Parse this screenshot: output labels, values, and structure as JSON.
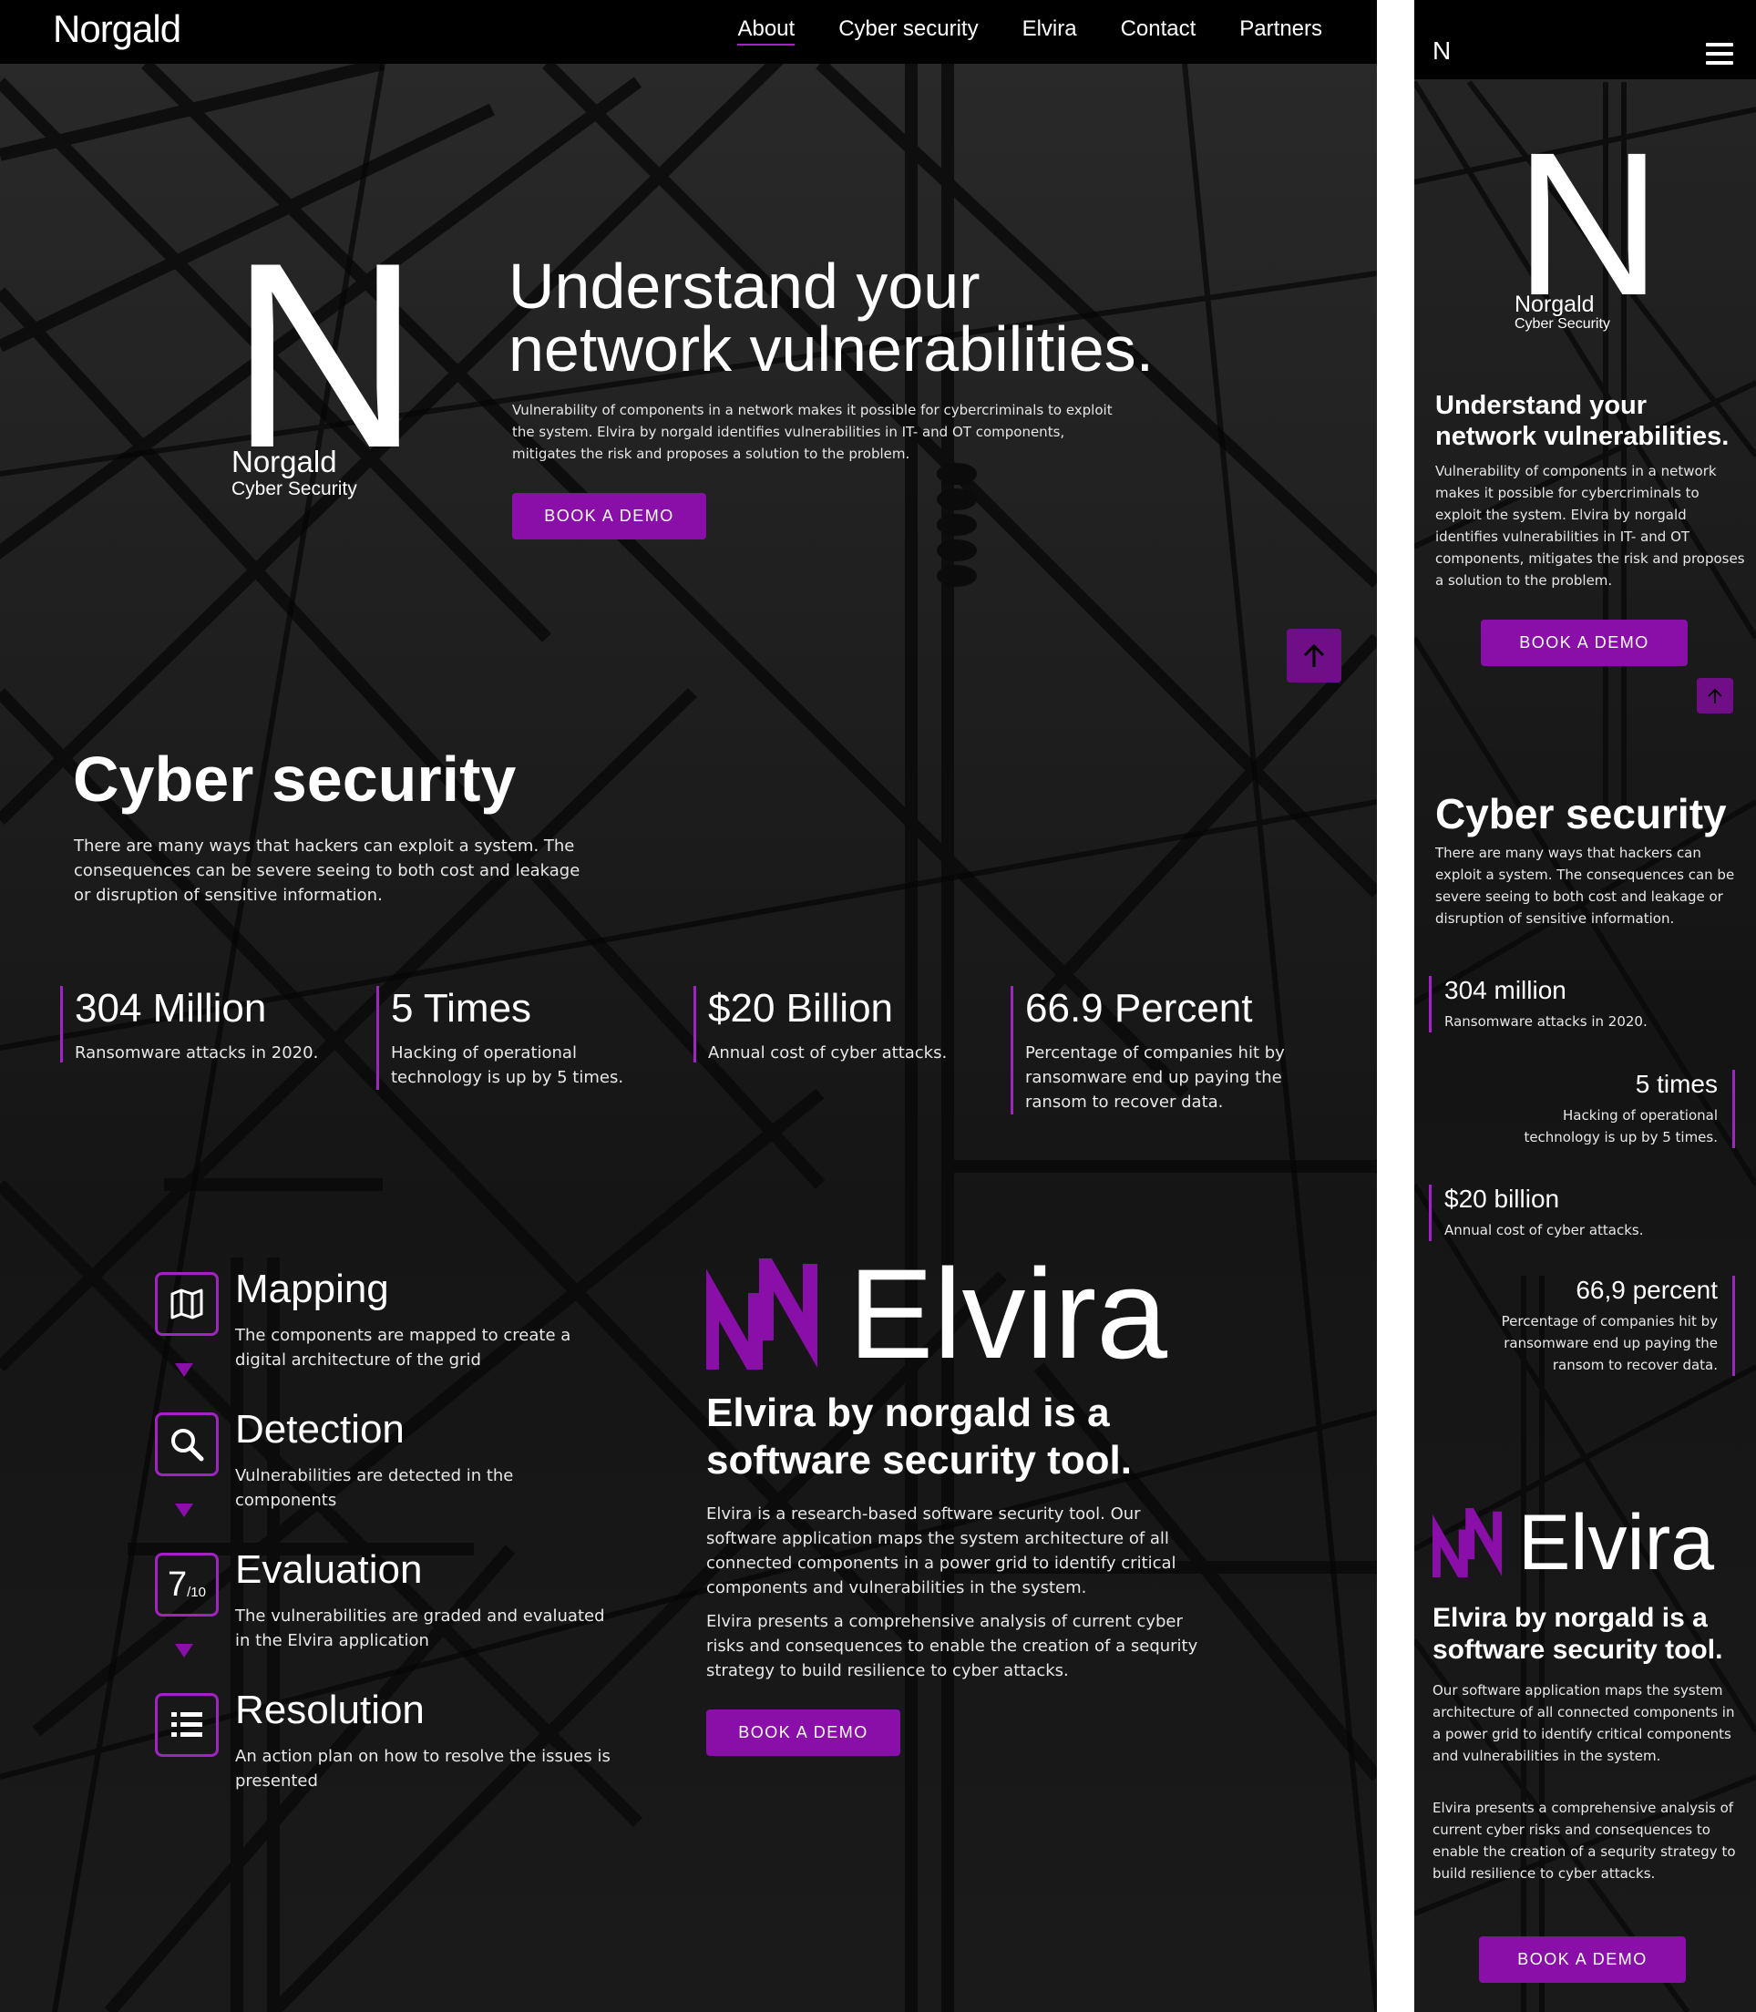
{
  "colors": {
    "accent": "#8a0fa8",
    "accent_line": "#a322c4",
    "background": "#121212",
    "nav": "#000000",
    "text": "#ffffff"
  },
  "desktop": {
    "logo": "Norgald",
    "nav": [
      "About",
      "Cyber security",
      "Elvira",
      "Contact",
      "Partners"
    ],
    "hero": {
      "mark_letter": "N",
      "brand": "Norgald",
      "brand_sub": "Cyber Security",
      "title_line1": "Understand your",
      "title_line2": "network vulnerabilities.",
      "text": "Vulnerability of components in a network makes it possible for cybercriminals to exploit the system. Elvira by norgald  identifies vulnerabilities in IT- and OT components, mitigates the risk and proposes a solution to the problem.",
      "button": "BOOK A DEMO"
    },
    "cyber": {
      "title": "Cyber security",
      "text": "There are many ways that hackers can exploit a system. The consequences can be severe seeing to both cost and leakage or disruption of sensitive information.",
      "stats": [
        {
          "value": "304 Million",
          "label": "Ransomware attacks in 2020."
        },
        {
          "value": "5 Times",
          "label": "Hacking of operational technology is up by 5 times."
        },
        {
          "value": "$20 Billion",
          "label": "Annual cost of cyber attacks."
        },
        {
          "value": "66.9 Percent",
          "label": "Percentage of companies hit by ransomware end up paying the ransom to recover data."
        }
      ]
    },
    "steps": [
      {
        "title": "Mapping",
        "text": "The components are mapped to create a digital architecture of the grid",
        "icon": "map-icon"
      },
      {
        "title": "Detection",
        "text": "Vulnerabilities are detected in the components",
        "icon": "search-icon"
      },
      {
        "title": "Evaluation",
        "text": "The vulnerabilities are graded and evaluated in the Elvira application",
        "icon": "score-icon",
        "icon_big": "7",
        "icon_small": "/10"
      },
      {
        "title": "Resolution",
        "text": "An action plan on how to resolve the issues is presented",
        "icon": "list-icon"
      }
    ],
    "elvira": {
      "logo_word": "Elvira",
      "subtitle": "Elvira by norgald is a software security tool.",
      "p1": "Elvira is a research-based software security tool. Our software application maps the system architecture of all connected components in a power grid to identify critical components and vulnerabilities in the system.",
      "p2": "Elvira presents a comprehensive analysis of current cyber risks and consequences to enable the creation  of a sequrity strategy to build resilience to cyber attacks.",
      "button": "BOOK A DEMO"
    }
  },
  "mobile": {
    "logo_letter": "N",
    "hero": {
      "mark_letter": "N",
      "brand": "Norgald",
      "brand_sub": "Cyber Security",
      "title": "Understand your network vulnerabilities.",
      "text": "Vulnerability of components in a network makes it possible for cybercriminals to exploit the system. Elvira by norgald identifies vulnerabilities in IT- and OT components, mitigates the risk and proposes a solution to the problem.",
      "button": "BOOK A DEMO"
    },
    "cyber": {
      "title": "Cyber security",
      "text": "There are many ways that hackers can exploit a system. The consequences can be severe seeing to both cost and leakage or disruption of sensitive information.",
      "stats": [
        {
          "value": "304 million",
          "label": "Ransomware attacks in 2020."
        },
        {
          "value": "5 times",
          "label": "Hacking of operational technology is up by 5 times."
        },
        {
          "value": "$20 billion",
          "label": "Annual cost of cyber attacks."
        },
        {
          "value": "66,9 percent",
          "label": "Percentage of companies hit by ransomware end up paying the ransom to recover data."
        }
      ]
    },
    "elvira": {
      "logo_word": "Elvira",
      "subtitle": "Elvira by norgald is a software security tool.",
      "p1": "Our software application maps the system architecture of all connected components in a power grid to identify critical components and vulnerabilities in the system.",
      "p2": "Elvira presents a comprehensive analysis of current cyber risks and consequences to enable the creation  of a sequrity strategy to build resilience to cyber attacks.",
      "button": "BOOK A DEMO"
    }
  }
}
